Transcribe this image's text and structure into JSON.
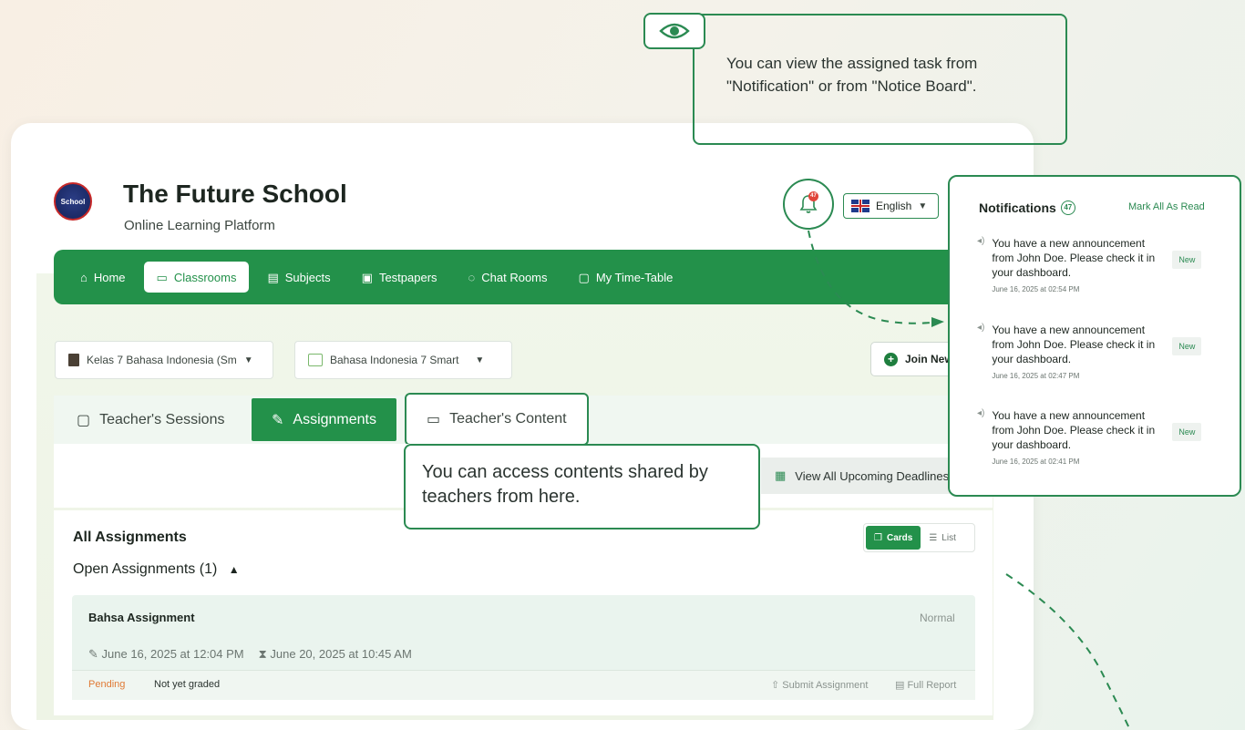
{
  "header": {
    "logo_text": "School",
    "title": "The Future School",
    "subtitle": "Online Learning Platform"
  },
  "nav": {
    "items": [
      {
        "label": "Home",
        "icon": "home-icon"
      },
      {
        "label": "Classrooms",
        "icon": "book-icon"
      },
      {
        "label": "Subjects",
        "icon": "notebook-icon"
      },
      {
        "label": "Testpapers",
        "icon": "testpaper-icon"
      },
      {
        "label": "Chat Rooms",
        "icon": "chat-icon"
      },
      {
        "label": "My Time-Table",
        "icon": "calendar-icon"
      }
    ],
    "active": "Classrooms"
  },
  "filters": {
    "class_select": "Kelas 7 Bahasa Indonesia (Sm",
    "subject_select": "Bahasa Indonesia 7 Smart",
    "join_button": "Join New"
  },
  "tabs": [
    {
      "label": "Teacher's Sessions"
    },
    {
      "label": "Assignments"
    },
    {
      "label": "Teacher's Content"
    }
  ],
  "deadline_button": "View All Upcoming Deadlines",
  "assignments": {
    "title": "All Assignments",
    "view_cards": "Cards",
    "view_list": "List",
    "open_label": "Open Assignments (1)",
    "items": [
      {
        "title": "Bahsa Assignment",
        "priority": "Normal",
        "start": "June 16, 2025 at 12:04 PM",
        "due": "June 20, 2025 at 10:45 AM",
        "status": "Pending",
        "grade": "Not yet graded",
        "submit": "Submit Assignment",
        "report": "Full Report"
      }
    ]
  },
  "language": "English",
  "bell_count": "47",
  "notifications": {
    "title": "Notifications",
    "count": "47",
    "mark_all": "Mark All As Read",
    "items": [
      {
        "text": "You have a new announcement from John Doe. Please check it in your dashboard.",
        "time": "June 16, 2025 at 02:54 PM",
        "badge": "New"
      },
      {
        "text": "You have a new announcement from John Doe. Please check it in your dashboard.",
        "time": "June 16, 2025 at 02:47 PM",
        "badge": "New"
      },
      {
        "text": "You have a new announcement from John Doe. Please check it in your dashboard.",
        "time": "June 16, 2025 at 02:41 PM",
        "badge": "New"
      }
    ]
  },
  "callouts": {
    "top": "You can view the assigned task from \"Notification\" or from \"Notice Board\".",
    "middle": "You can access contents shared by teachers from here."
  },
  "colors": {
    "primary": "#23914a",
    "accent_outline": "#2b8a52",
    "pending": "#e07a35",
    "badge_red": "#e0453a"
  }
}
